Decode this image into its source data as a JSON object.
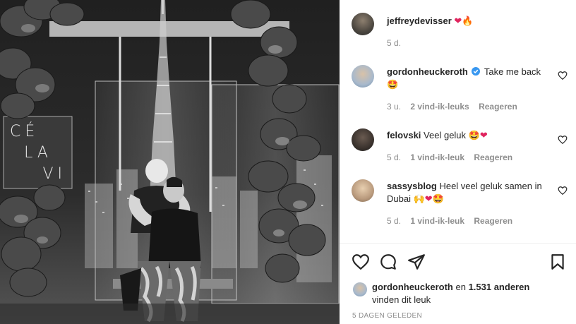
{
  "photo": {
    "sign_text": [
      "CÉ",
      "LA",
      "VI"
    ]
  },
  "post": {
    "author": "jeffreydevisser",
    "author_time": "5 d."
  },
  "comments": [
    {
      "user": "gordonheuckeroth",
      "verified": true,
      "text": "Take me back",
      "time": "3 u.",
      "likes": "2 vind-ik-leuks",
      "reply": "Reageren"
    },
    {
      "user": "felovski",
      "verified": false,
      "text": "Veel geluk",
      "time": "5 d.",
      "likes": "1 vind-ik-leuk",
      "reply": "Reageren"
    },
    {
      "user": "sassysblog",
      "verified": false,
      "text_line1": "Heel veel geluk samen in",
      "text_line2": "Dubai",
      "time": "5 d.",
      "likes": "1 vind-ik-leuk",
      "reply": "Reageren"
    }
  ],
  "actions": {
    "like_icon": "heart-outline-icon",
    "comment_icon": "comment-bubble-icon",
    "share_icon": "paper-plane-icon",
    "save_icon": "bookmark-icon"
  },
  "likes": {
    "user": "gordonheuckeroth",
    "and_text": "en",
    "count": "1.531 anderen",
    "suffix": "vinden dit leuk"
  },
  "posted_date": "5 DAGEN GELEDEN",
  "colors": {
    "verified_blue": "#3897f0",
    "heart_red": "#e0245e",
    "meta_gray": "#8e8e8e",
    "text_dark": "#262626"
  }
}
